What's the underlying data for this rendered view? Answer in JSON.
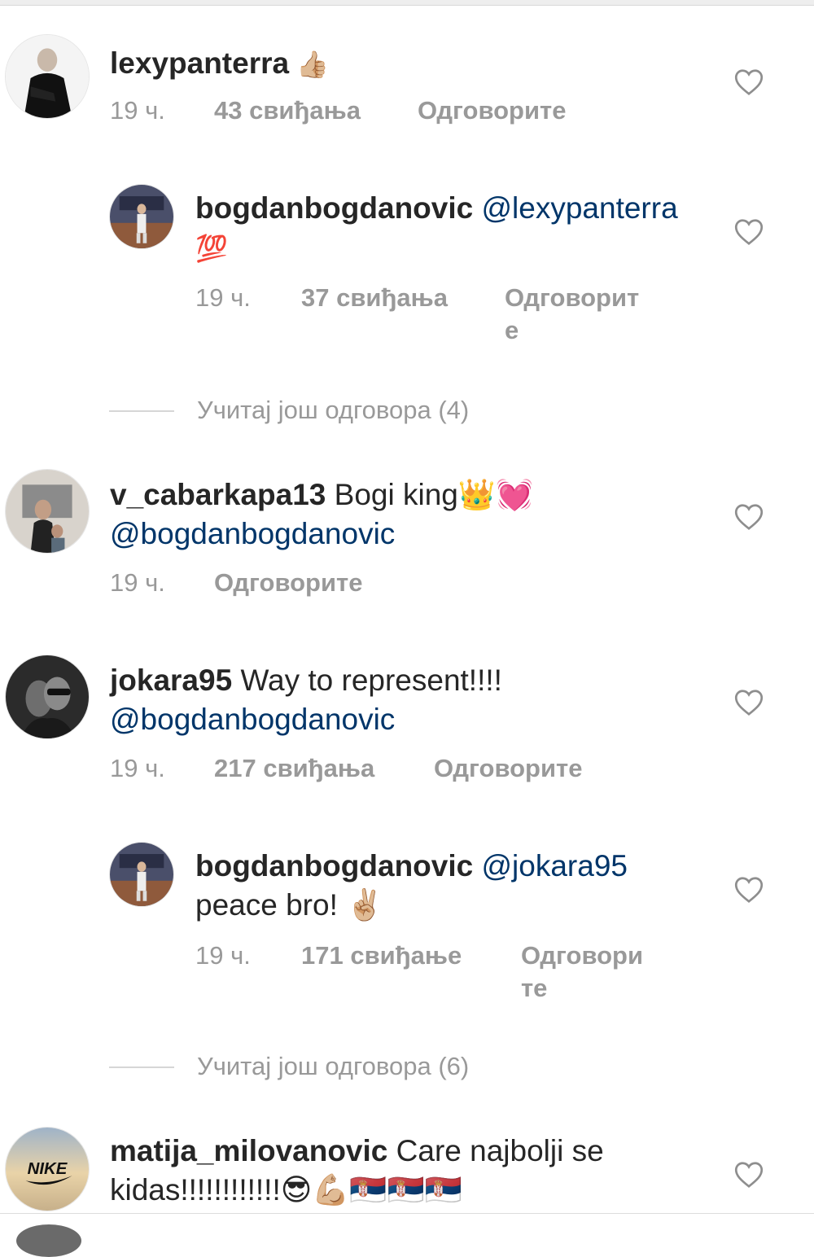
{
  "comments": [
    {
      "username": "lexypanterra",
      "text_before": "",
      "mention": "",
      "text_after": " 👍🏼",
      "time": "19 ч.",
      "likes": "43 свиђања",
      "reply_label": "Одговорите"
    },
    {
      "username": "bogdanbogdanovic",
      "mention": "@lexypanterra",
      "text_after": "💯",
      "time": "19 ч.",
      "likes": "37 свиђања",
      "reply_label": "Одговорите"
    },
    {
      "load_more": "Учитај још одговора (4)"
    },
    {
      "username": "v_cabarkapa13",
      "text_before": " Bogi king👑💓",
      "mention": "@bogdanbogdanovic",
      "time": "19 ч.",
      "reply_label": "Одговорите"
    },
    {
      "username": "jokara95",
      "text_before": " Way to represent!!!!",
      "mention": "@bogdanbogdanovic",
      "time": "19 ч.",
      "likes": "217 свиђања",
      "reply_label": "Одговорите"
    },
    {
      "username": "bogdanbogdanovic",
      "mention": "@jokara95",
      "text_after": "peace bro! ✌🏼",
      "time": "19 ч.",
      "likes": "171 свиђање",
      "reply_label": "Одговорите"
    },
    {
      "load_more": "Учитај још одговора (6)"
    },
    {
      "username": "matija_milovanovic",
      "text_before": " Care najbolji se kidas!!!!!!!!!!!!😎💪🏼🇷🇸🇷🇸🇷🇸"
    }
  ],
  "colors": {
    "mention": "#003569",
    "meta": "#999999",
    "text": "#262626"
  },
  "icons": {
    "like": "heart-outline-icon"
  }
}
